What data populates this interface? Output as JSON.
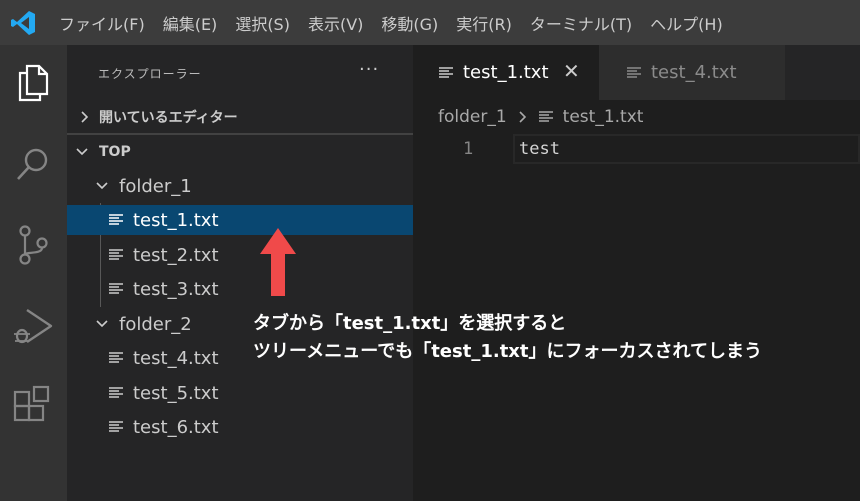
{
  "menu": {
    "items": [
      "ファイル(F)",
      "編集(E)",
      "選択(S)",
      "表示(V)",
      "移動(G)",
      "実行(R)",
      "ターミナル(T)",
      "ヘルプ(H)"
    ]
  },
  "activity": {
    "icons": [
      "files-icon",
      "search-icon",
      "source-control-icon",
      "run-debug-icon",
      "extensions-icon"
    ]
  },
  "explorer": {
    "title": "エクスプローラー",
    "more": "···",
    "open_editors": "開いているエディター",
    "root": "TOP",
    "folder1": "folder_1",
    "folder1_files": [
      "test_1.txt",
      "test_2.txt",
      "test_3.txt"
    ],
    "folder2": "folder_2",
    "folder2_files": [
      "test_4.txt",
      "test_5.txt",
      "test_6.txt"
    ],
    "selected_file": "test_1.txt"
  },
  "tabs": {
    "active": "test_1.txt",
    "inactive": "test_4.txt",
    "close": "✕"
  },
  "breadcrumb": {
    "folder": "folder_1",
    "file": "test_1.txt"
  },
  "editor": {
    "line_number": "1",
    "content": "test"
  },
  "annotation": {
    "line1": "タブから「test_1.txt」を選択すると",
    "line2": "ツリーメニューでも「test_1.txt」にフォーカスされてしまう",
    "arrow_color": "#f04a4a"
  },
  "colors": {
    "titlebar": "#3c3c3c",
    "activitybar": "#333333",
    "sidebar": "#252526",
    "selection": "#094771",
    "editor": "#1e1e1e",
    "vscode_blue": "#23a9f2"
  }
}
